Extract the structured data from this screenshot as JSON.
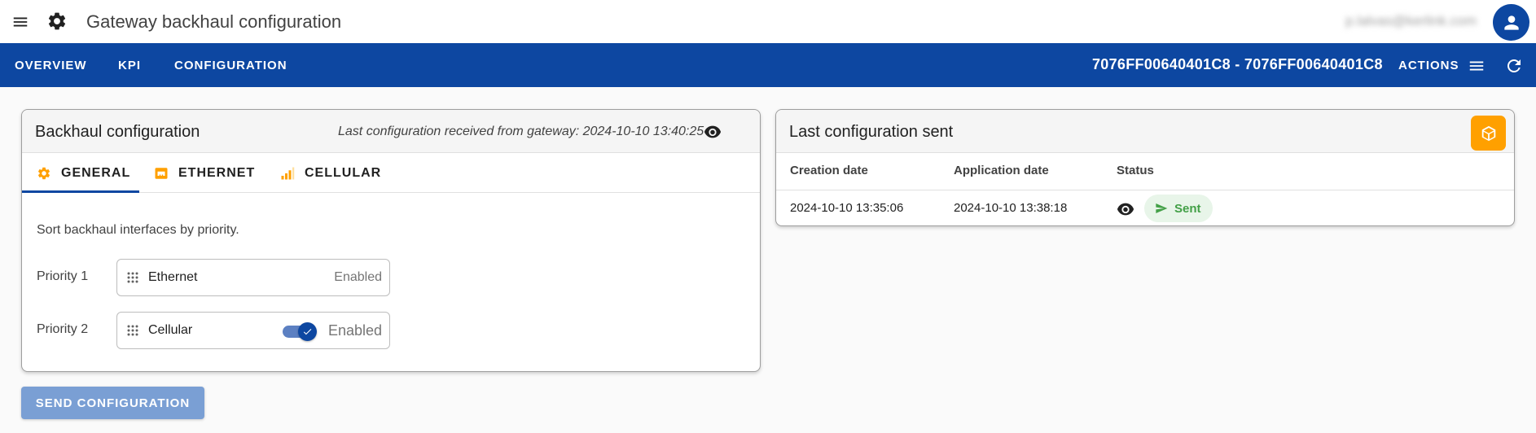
{
  "header": {
    "title": "Gateway backhaul configuration",
    "user_email": "p.lalvas@kerlink.com"
  },
  "nav": {
    "tabs": [
      "OVERVIEW",
      "KPI",
      "CONFIGURATION"
    ],
    "gateway_id": "7076FF00640401C8 - 7076FF00640401C8",
    "actions_label": "ACTIONS"
  },
  "backhaul": {
    "title": "Backhaul configuration",
    "last_received": "Last configuration received from gateway: 2024-10-10 13:40:25",
    "tabs": [
      "GENERAL",
      "ETHERNET",
      "CELLULAR"
    ],
    "active_tab": "GENERAL",
    "sort_text": "Sort backhaul interfaces by priority.",
    "priorities": [
      {
        "label": "Priority 1",
        "name": "Ethernet",
        "status": "Enabled"
      },
      {
        "label": "Priority 2",
        "name": "Cellular",
        "status": "Enabled",
        "toggle_on": true
      }
    ],
    "send_button": "SEND CONFIGURATION"
  },
  "last_sent": {
    "title": "Last configuration sent",
    "columns": [
      "Creation date",
      "Application date",
      "Status"
    ],
    "rows": [
      {
        "creation": "2024-10-10 13:35:06",
        "application": "2024-10-10 13:38:18",
        "status": "Sent"
      }
    ]
  },
  "colors": {
    "primary": "#0d47a1",
    "accent": "#ffa000",
    "success": "#43a047",
    "button_disabled": "#7a9fd4"
  },
  "icons": {
    "menu": "menu-icon",
    "app": "gear-icon",
    "avatar": "person-icon",
    "refresh": "refresh-icon",
    "view": "eye-icon",
    "cube": "cube-icon",
    "sent": "send-icon"
  }
}
